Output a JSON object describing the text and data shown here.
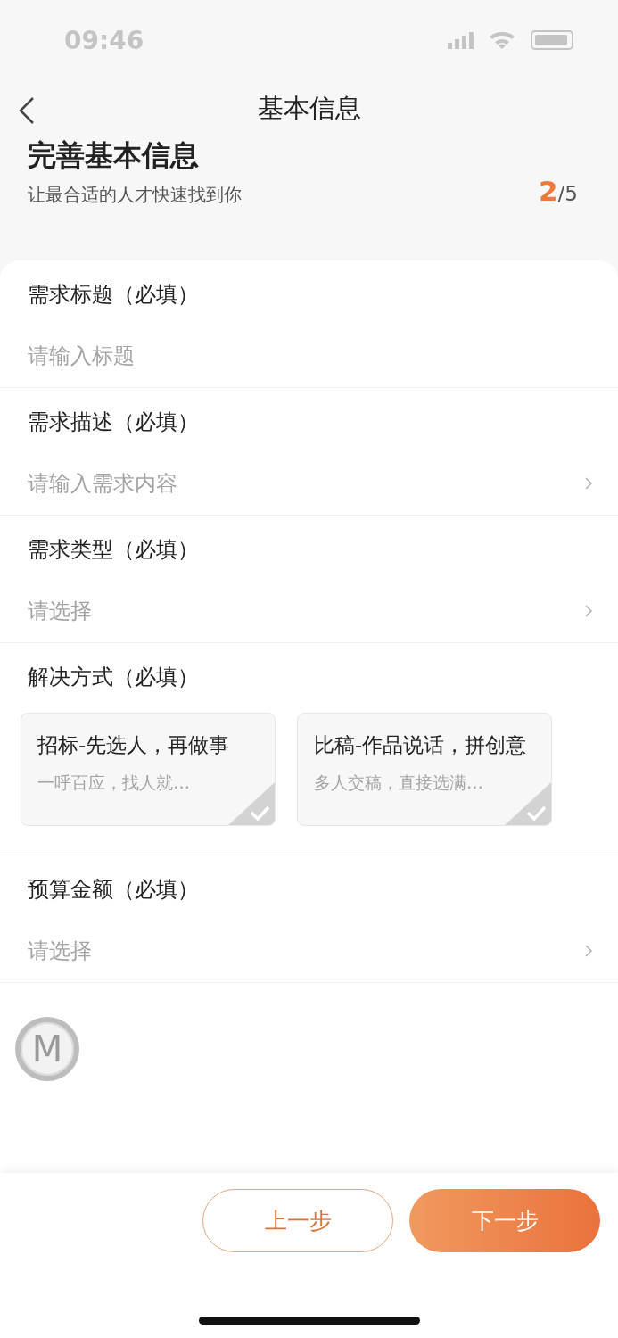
{
  "status_bar": {
    "time": "09:46"
  },
  "nav": {
    "title": "基本信息"
  },
  "header": {
    "title": "完善基本信息",
    "subtitle": "让最合适的人才快速找到你",
    "step_current": "2",
    "step_total": "/5"
  },
  "fields": [
    {
      "kind": "input",
      "label": "需求标题（必填）",
      "placeholder": "请输入标题"
    },
    {
      "kind": "select",
      "label": "需求描述（必填）",
      "placeholder": "请输入需求内容"
    },
    {
      "kind": "select",
      "label": "需求类型（必填）",
      "placeholder": "请选择"
    },
    {
      "kind": "options",
      "label": "解决方式（必填）",
      "options": [
        {
          "title": "招标-先选人，再做事",
          "desc": "一呼百应，找人就…",
          "selected": false
        },
        {
          "title": "比稿-作品说话，拼创意",
          "desc": "多人交稿，直接选满…",
          "selected": false
        }
      ]
    },
    {
      "kind": "select",
      "label": "预算金额（必填）",
      "placeholder": "请选择"
    }
  ],
  "floating_button": {
    "label": "M"
  },
  "buttons": [
    {
      "kind": "secondary",
      "label": "上一步"
    },
    {
      "kind": "primary",
      "label": "下一步"
    }
  ]
}
